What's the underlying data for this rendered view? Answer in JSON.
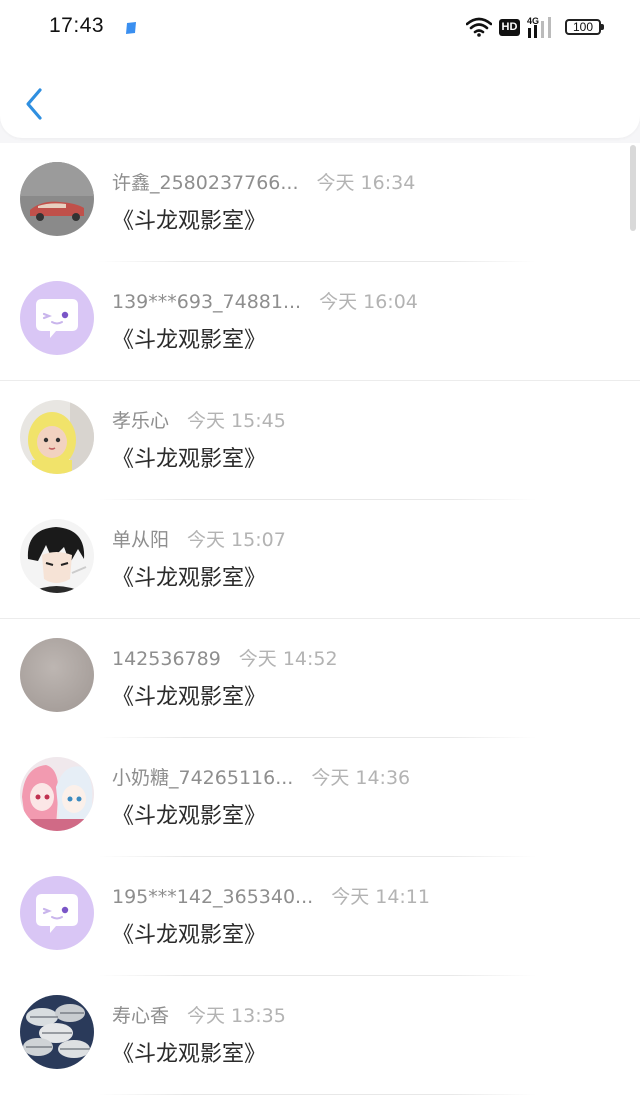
{
  "status_bar": {
    "time": "17:43",
    "hd": "HD",
    "network": "4G",
    "battery": "100"
  },
  "nav": {
    "back_icon": "chevron-left-icon"
  },
  "items": [
    {
      "name": "许鑫_2580237766...",
      "time": "今天 16:34",
      "title": "《斗龙观影室》",
      "avatar": "car-photo"
    },
    {
      "name": "139***693_74881...",
      "time": "今天 16:04",
      "title": "《斗龙观影室》",
      "avatar": "chat-bubble-icon"
    },
    {
      "name": "孝乐心",
      "time": "今天 15:45",
      "title": "《斗龙观影室》",
      "avatar": "child-photo"
    },
    {
      "name": "单从阳",
      "time": "今天 15:07",
      "title": "《斗龙观影室》",
      "avatar": "anime-boy"
    },
    {
      "name": "142536789",
      "time": "今天 14:52",
      "title": "《斗龙观影室》",
      "avatar": "blank-photo"
    },
    {
      "name": "小奶糖_74265116...",
      "time": "今天 14:36",
      "title": "《斗龙观影室》",
      "avatar": "anime-girls"
    },
    {
      "name": "195***142_365340...",
      "time": "今天 14:11",
      "title": "《斗龙观影室》",
      "avatar": "chat-bubble-icon"
    },
    {
      "name": "寿心香",
      "time": "今天 13:35",
      "title": "《斗龙观影室》",
      "avatar": "fish-photo"
    }
  ],
  "colors": {
    "accent": "#2f8fe0",
    "name_text": "#8e8e8e",
    "time_text": "#b3b3b3",
    "title_text": "#2b2b2b",
    "bubble_bg": "#d9c6f5"
  }
}
